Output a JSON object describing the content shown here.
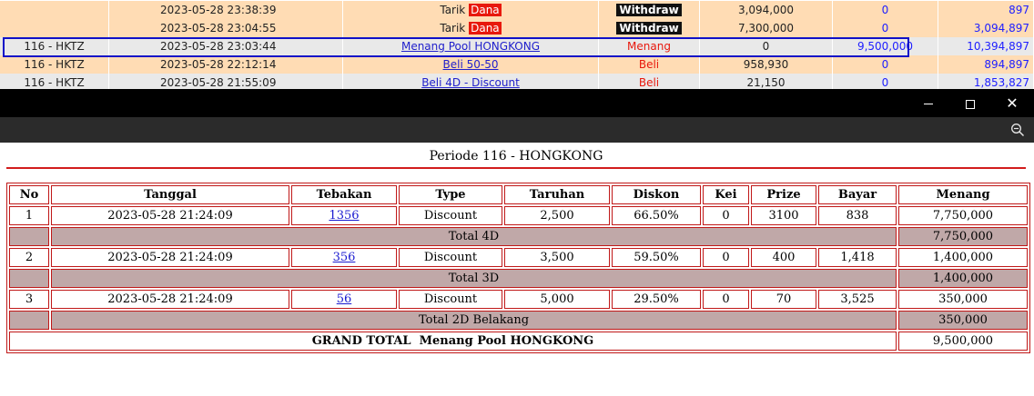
{
  "background_list": {
    "rows": [
      {
        "col0": "",
        "date": "2023-05-28 23:38:39",
        "desc_prefix": "Tarik",
        "desc_badge": "Dana",
        "type": "Withdraw",
        "amount": "3,094,000",
        "win": "0",
        "balance": "897"
      },
      {
        "col0": "",
        "date": "2023-05-28 23:04:55",
        "desc_prefix": "Tarik",
        "desc_badge": "Dana",
        "type": "Withdraw",
        "amount": "7,300,000",
        "win": "0",
        "balance": "3,094,897"
      },
      {
        "col0": "116 - HKTZ",
        "date": "2023-05-28 23:03:44",
        "desc_link": "Menang Pool HONGKONG",
        "type": "Menang",
        "amount": "0",
        "win": "9,500,000",
        "balance": "10,394,897"
      },
      {
        "col0": "116 - HKTZ",
        "date": "2023-05-28 22:12:14",
        "desc_link": "Beli 50-50",
        "type": "Beli",
        "amount": "958,930",
        "win": "0",
        "balance": "894,897"
      },
      {
        "col0": "116 - HKTZ",
        "date": "2023-05-28 21:55:09",
        "desc_link": "Beli 4D - Discount",
        "type": "Beli",
        "amount": "21,150",
        "win": "0",
        "balance": "1,853,827"
      }
    ]
  },
  "window": {
    "close_glyph": "✕"
  },
  "report": {
    "periode": "Periode 116 - HONGKONG",
    "headers": [
      "No",
      "Tanggal",
      "Tebakan",
      "Type",
      "Taruhan",
      "Diskon",
      "Kei",
      "Prize",
      "Bayar",
      "Menang"
    ],
    "groups": [
      {
        "row": {
          "no": "1",
          "tanggal": "2023-05-28 21:24:09",
          "tebakan": "1356",
          "type": "Discount",
          "taruhan": "2,500",
          "diskon": "66.50%",
          "kei": "0",
          "prize": "3100",
          "bayar": "838",
          "menang": "7,750,000"
        },
        "total_label": "Total 4D",
        "total_value": "7,750,000"
      },
      {
        "row": {
          "no": "2",
          "tanggal": "2023-05-28 21:24:09",
          "tebakan": "356",
          "type": "Discount",
          "taruhan": "3,500",
          "diskon": "59.50%",
          "kei": "0",
          "prize": "400",
          "bayar": "1,418",
          "menang": "1,400,000"
        },
        "total_label": "Total 3D",
        "total_value": "1,400,000"
      },
      {
        "row": {
          "no": "3",
          "tanggal": "2023-05-28 21:24:09",
          "tebakan": "56",
          "type": "Discount",
          "taruhan": "5,000",
          "diskon": "29.50%",
          "kei": "0",
          "prize": "70",
          "bayar": "3,525",
          "menang": "350,000"
        },
        "total_label": "Total 2D Belakang",
        "total_value": "350,000"
      }
    ],
    "grand_total_label": "GRAND TOTAL  Menang Pool HONGKONG",
    "grand_total_value": "9,500,000"
  },
  "colors": {
    "peach_row": "#ffdcb4",
    "grey_row": "#e9e9e9",
    "highlight_border": "#1010c8",
    "table_border": "#c01818",
    "total_row": "#c0a8a8",
    "dana_badge": "#e8180c"
  }
}
